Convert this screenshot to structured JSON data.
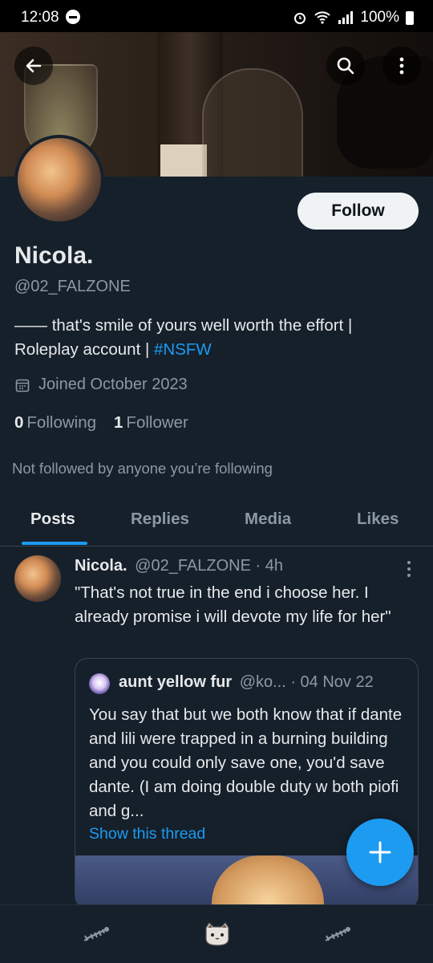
{
  "status_bar": {
    "time": "12:08",
    "battery": "100%",
    "icons": [
      "dnd-icon",
      "alarm-icon",
      "wifi-icon",
      "signal-icon",
      "battery-icon"
    ]
  },
  "header": {
    "back_icon": "arrow-left-icon",
    "search_icon": "search-icon",
    "more_icon": "more-vertical-icon"
  },
  "profile": {
    "name": "Nicola.",
    "handle": "@02_FALZONE",
    "bio_prefix": "—— that's smile of yours well worth the effort | Roleplay account | ",
    "bio_hashtag": "#NSFW",
    "joined": "Joined October 2023",
    "following_count": "0",
    "following_label": "Following",
    "followers_count": "1",
    "followers_label": "Follower",
    "not_followed": "Not followed by anyone you’re following",
    "follow_button": "Follow"
  },
  "tabs": [
    "Posts",
    "Replies",
    "Media",
    "Likes"
  ],
  "tweet": {
    "name": "Nicola.",
    "handle_time": "@02_FALZONE · 4h",
    "text": "\"That's not true in the end i choose her. I already promise i will devote my life for her\"",
    "quote": {
      "name": "aunt yellow fur",
      "handle_date": "@ko...  · 04 Nov 22",
      "text": "You say that but we both know that if dante and lili were trapped in a burning building and you could only save one, you'd save dante. (I am doing double duty w both piofi and g...",
      "show_thread": "Show this thread"
    }
  },
  "colors": {
    "background": "#15202b",
    "accent": "#1d9bf0",
    "text_primary": "#e7e9ea",
    "text_secondary": "#8b98a5"
  },
  "bottom_nav": [
    "fish-skeleton-icon",
    "cat-face-icon",
    "fish-skeleton-icon"
  ]
}
